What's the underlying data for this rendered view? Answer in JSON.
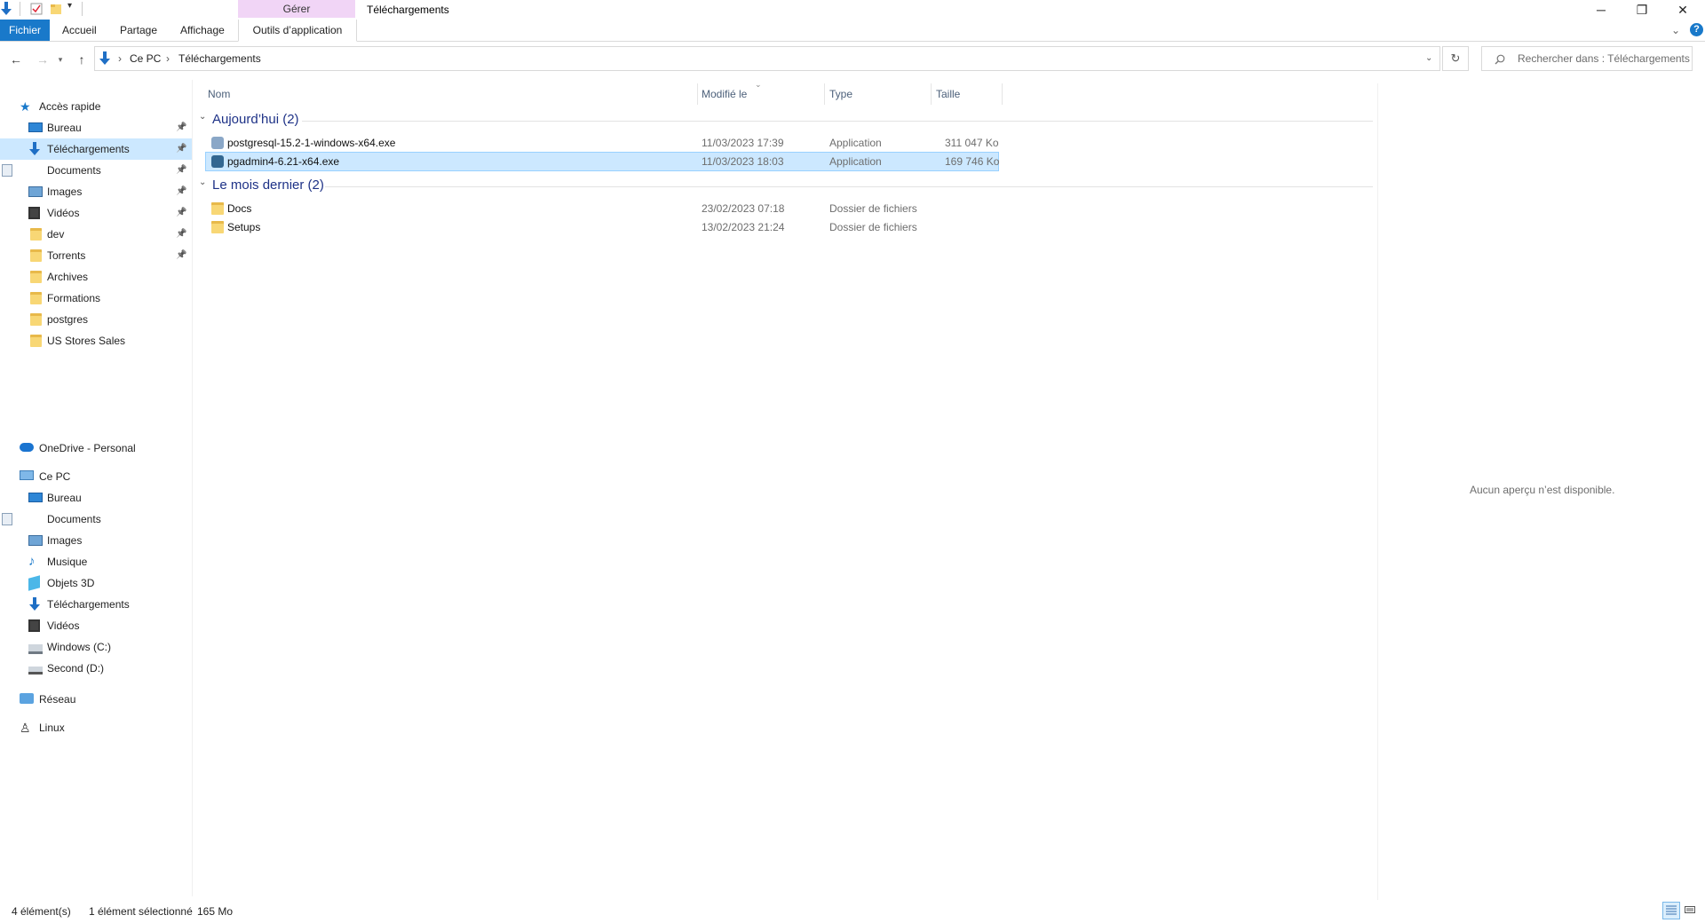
{
  "titlebar": {
    "title": "Téléchargements",
    "contextual_group": "Gérer",
    "controls": {
      "minimize": "─",
      "restore": "❐",
      "close": "✕"
    }
  },
  "ribbon": {
    "tabs": [
      "Fichier",
      "Accueil",
      "Partage",
      "Affichage",
      "Outils d’application"
    ],
    "help": "?",
    "expand": "⌄"
  },
  "address": {
    "crumbs": [
      "Ce PC",
      "Téléchargements"
    ],
    "separator": "›",
    "search_placeholder": "Rechercher dans : Téléchargements"
  },
  "nav": {
    "quick_access": "Accès rapide",
    "quick_items": [
      {
        "label": "Bureau",
        "pinned": true
      },
      {
        "label": "Téléchargements",
        "pinned": true,
        "selected": true
      },
      {
        "label": "Documents",
        "pinned": true
      },
      {
        "label": "Images",
        "pinned": true
      },
      {
        "label": "Vidéos",
        "pinned": true
      },
      {
        "label": "dev",
        "pinned": true
      },
      {
        "label": "Torrents",
        "pinned": true
      },
      {
        "label": "Archives"
      },
      {
        "label": "Formations"
      },
      {
        "label": "postgres"
      },
      {
        "label": "US Stores Sales"
      }
    ],
    "onedrive": "OneDrive - Personal",
    "this_pc": "Ce PC",
    "pc_items": [
      "Bureau",
      "Documents",
      "Images",
      "Musique",
      "Objets 3D",
      "Téléchargements",
      "Vidéos",
      "Windows (C:)",
      "Second (D:)"
    ],
    "network": "Réseau",
    "linux": "Linux"
  },
  "columns": {
    "name": "Nom",
    "modified": "Modifié le",
    "type": "Type",
    "size": "Taille"
  },
  "groups": [
    {
      "title": "Aujourd’hui (2)",
      "files": [
        {
          "name": "postgresql-15.2-1-windows-x64.exe",
          "modified": "11/03/2023 17:39",
          "type": "Application",
          "size": "311 047 Ko"
        },
        {
          "name": "pgadmin4-6.21-x64.exe",
          "modified": "11/03/2023 18:03",
          "type": "Application",
          "size": "169 746 Ko",
          "selected": true
        }
      ]
    },
    {
      "title": "Le mois dernier (2)",
      "files": [
        {
          "name": "Docs",
          "modified": "23/02/2023 07:18",
          "type": "Dossier de fichiers",
          "size": ""
        },
        {
          "name": "Setups",
          "modified": "13/02/2023 21:24",
          "type": "Dossier de fichiers",
          "size": ""
        }
      ]
    }
  ],
  "preview": {
    "empty_text": "Aucun aperçu n’est disponible."
  },
  "status": {
    "count": "4 élément(s)",
    "selection": "1 élément sélectionné",
    "size": "165 Mo"
  },
  "colors": {
    "accent": "#1979ca",
    "selection": "#cce8ff",
    "group_text": "#1e3287",
    "gerer_tab": "#f1d5f6"
  }
}
